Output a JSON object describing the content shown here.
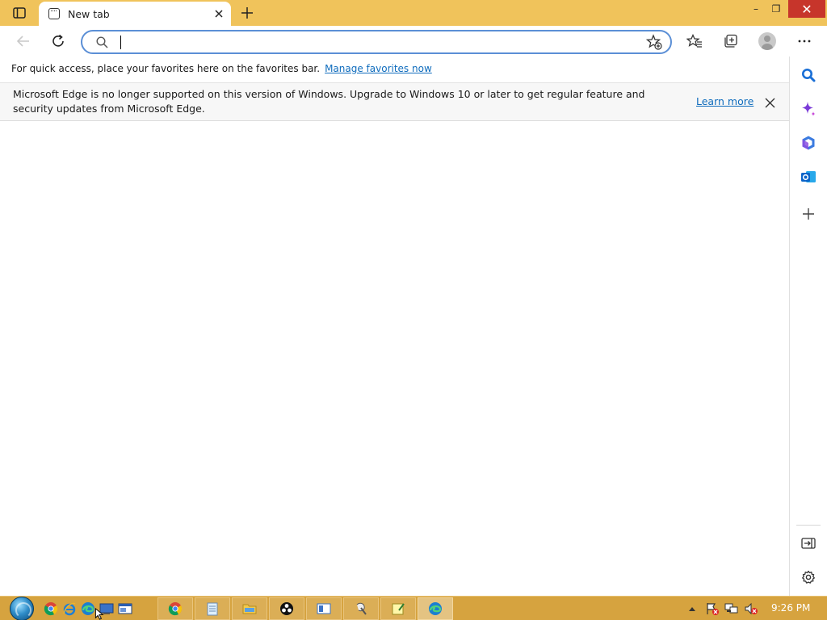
{
  "tabs": [
    {
      "title": "New tab"
    }
  ],
  "address_bar": {
    "value": "",
    "placeholder": ""
  },
  "favorites_bar": {
    "message": "For quick access, place your favorites here on the favorites bar.",
    "link": "Manage favorites now"
  },
  "infobar": {
    "message": "Microsoft Edge is no longer supported on this version of Windows. Upgrade to Windows 10 or later to get regular feature and security updates from Microsoft Edge.",
    "link": "Learn more"
  },
  "window_controls": {
    "minimize": "–",
    "restore": "❐",
    "close": "✕"
  },
  "taskbar": {
    "clock": "9:26 PM",
    "quick_launch": [
      "chrome-icon",
      "internet-explorer-icon",
      "edge-icon",
      "show-desktop-icon",
      "switch-windows-icon"
    ],
    "items": [
      "chrome-icon",
      "notepad-icon",
      "file-explorer-icon",
      "obs-icon",
      "app-window-icon",
      "paint-icon",
      "sticky-notes-icon",
      "edge-icon"
    ],
    "tray": [
      "show-hidden-icons-icon",
      "action-center-flag-icon",
      "network-icon",
      "volume-muted-icon"
    ]
  },
  "colors": {
    "titlebar": "#f0c35b",
    "taskbar": "#d6a33f",
    "accent_link": "#0f6cbd",
    "close_button": "#c7352b"
  }
}
